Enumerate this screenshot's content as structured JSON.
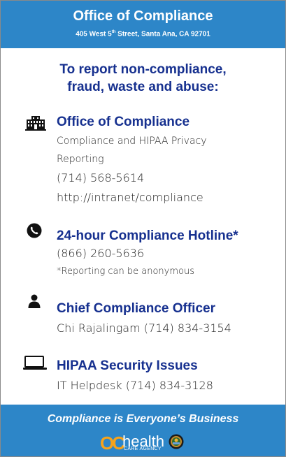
{
  "header": {
    "title": "Office of Compliance",
    "address_prefix": "405 West 5",
    "address_sup": "th",
    "address_suffix": " Street, Santa Ana, CA 92701"
  },
  "intro": {
    "line1": "To report non-compliance,",
    "line2": "fraud, waste and abuse:"
  },
  "sections": [
    {
      "icon": "building-icon",
      "title": "Office of Compliance",
      "lines": [
        "Compliance and HIPAA Privacy",
        "Reporting",
        "(714) 568-5614",
        "http://intranet/compliance"
      ]
    },
    {
      "icon": "phone-icon",
      "title": "24-hour Compliance Hotline*",
      "lines": [
        "(866) 260-5636",
        "*Reporting can be anonymous"
      ]
    },
    {
      "icon": "person-icon",
      "title": "Chief Compliance Officer",
      "lines": [
        "Chi Rajalingam (714) 834-3154"
      ]
    },
    {
      "icon": "monitor-icon",
      "title": "HIPAA Security Issues",
      "lines": [
        "IT Helpdesk (714) 834-3128"
      ]
    }
  ],
  "footer": {
    "tagline": "Compliance is Everyone’s Business",
    "logo_oc": "OC",
    "logo_health": "health",
    "logo_agency": "CARE AGENCY"
  },
  "colors": {
    "banner": "#2d86c8",
    "heading": "#16308f",
    "logo_orange": "#f6a31b"
  }
}
